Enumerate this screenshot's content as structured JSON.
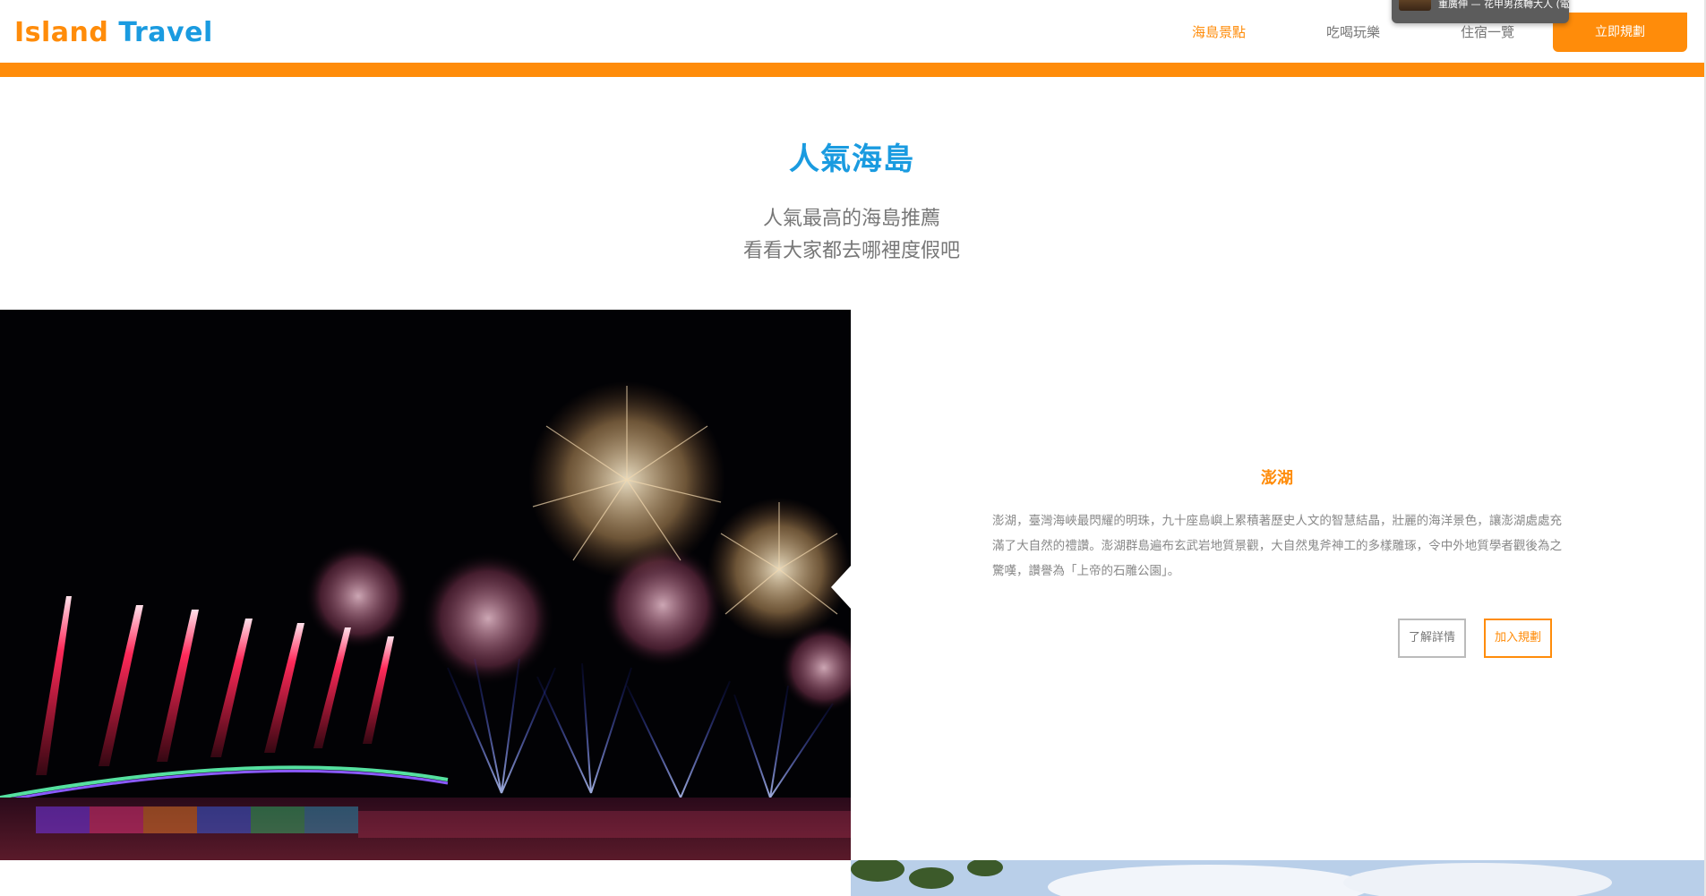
{
  "header": {
    "logo_part1": "Island",
    "logo_part2": " Travel",
    "nav": [
      {
        "label": "海島景點"
      },
      {
        "label": "吃喝玩樂"
      },
      {
        "label": "住宿一覽"
      }
    ],
    "cta_label": "立即規劃"
  },
  "notification": {
    "text": "重廣伸 — 花甲男孩轉大人 (電視原聲帶)"
  },
  "section": {
    "title": "人氣海島",
    "subtitle_line1": "人氣最高的海島推薦",
    "subtitle_line2": "看看大家都去哪裡度假吧"
  },
  "feature": {
    "place_name": "澎湖",
    "description": "澎湖，臺灣海峽最閃耀的明珠，九十座島嶼上累積著歷史人文的智慧結晶，壯麗的海洋景色，讓澎湖處處充滿了大自然的禮讚。澎湖群島遍布玄武岩地質景觀，大自然鬼斧神工的多樣雕琢，令中外地質學者觀後為之驚嘆，讚譽為「上帝的石雕公園」。",
    "detail_button": "了解詳情",
    "add_button": "加入規劃"
  },
  "colors": {
    "accent_orange": "#ff8c0a",
    "accent_blue": "#1a9be0"
  }
}
